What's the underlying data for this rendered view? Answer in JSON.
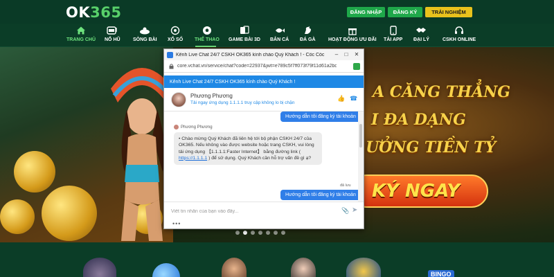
{
  "brand": {
    "name_main": "OK",
    "name_accent": "365"
  },
  "header": {
    "login_label": "ĐĂNG NHẬP",
    "register_label": "ĐĂNG KÝ",
    "trial_label": "TRẢI NGHIỆM"
  },
  "nav": {
    "items": [
      {
        "label": "TRANG CHỦ",
        "icon": "home-icon"
      },
      {
        "label": "NỔ HŨ",
        "icon": "slot-icon"
      },
      {
        "label": "SÒNG BÀI",
        "icon": "casino-icon"
      },
      {
        "label": "XỔ SỐ",
        "icon": "lottery-icon"
      },
      {
        "label": "THỂ THAO",
        "icon": "soccer-icon"
      },
      {
        "label": "GAME BÀI 3D",
        "icon": "cards-icon"
      },
      {
        "label": "BẮN CÁ",
        "icon": "fish-icon"
      },
      {
        "label": "ĐÁ GÀ",
        "icon": "rooster-icon"
      },
      {
        "label": "HOẠT ĐỘNG ƯU ĐÃI",
        "icon": "gift-icon"
      },
      {
        "label": "TẢI APP",
        "icon": "phone-icon"
      },
      {
        "label": "ĐẠI LÝ",
        "icon": "handshake-icon"
      },
      {
        "label": "CSKH ONLINE",
        "icon": "headset-icon"
      }
    ],
    "active": "THỂ THAO"
  },
  "banner": {
    "line1": "A CĂNG THẲNG",
    "line2": "I ĐA DẠNG",
    "line3": "ƯỞNG TIỀN TỶ",
    "cta": "KÝ NGAY"
  },
  "chat_window": {
    "window_title": "Kênh Live Chat 24/7 CSKH OK365 kính chào Quý Khách ! - Cốc Cốc",
    "url": "core.vchat.vn/service/chat?code=22937&jwt=e789c5f7ff073f79f11d61a2bd...",
    "chat_header": "Kênh Live Chat 24/7 CSKH OK365 kính chào Quý Khách !",
    "agent_name": "Phương Phương",
    "agent_sub": "Tải ngay ứng dụng 1.1.1.1 truy cập không lo bị chặn",
    "user_message": "Hướng dẫn tôi đăng ký tài khoản",
    "sender_label": "Phương Phương",
    "agent_message_part1": "• Chào mừng Quý Khách đã liên hệ tới bộ phận CSKH 24/7 của OK365. Nếu không vào được website hoặc trang CSKH, vui lòng tải ứng dụng 【1.1.1.1:Faster Internet】 bằng đường link ( ",
    "agent_message_link": "https://1.1.1.1",
    "agent_message_part2": " ) để sử dụng. Quý Khách cần hỗ trợ vấn đề gì ạ?",
    "status_small": "đã lưu",
    "user_message_2": "Hướng dẫn tôi đăng ký tài khoản",
    "composer_placeholder": "Viết tin nhắn của bạn vào đây...",
    "more_label": "•••"
  },
  "colors": {
    "brand_green": "#58d06a",
    "nav_bg": "#0b3d27",
    "button_green": "#1fa84a",
    "button_yellow": "#e9c21c",
    "chat_blue": "#1e88e5"
  }
}
